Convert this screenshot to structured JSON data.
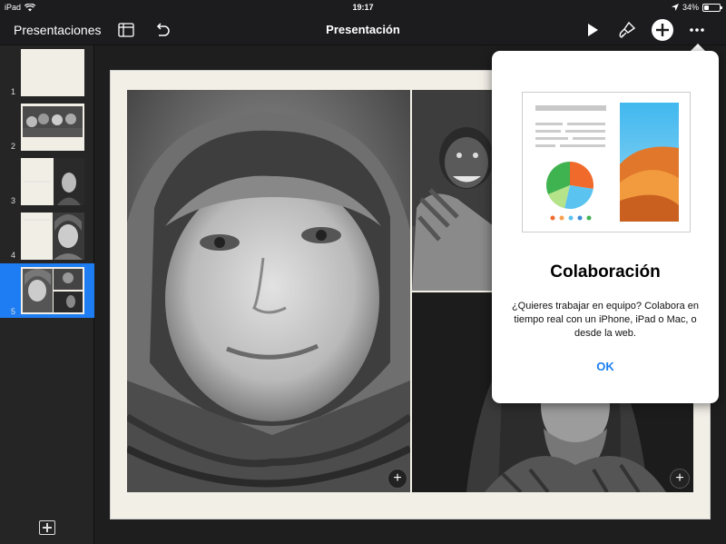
{
  "status_bar": {
    "device": "iPad",
    "time": "19:17",
    "battery": "34%",
    "battery_level": 0.34
  },
  "toolbar": {
    "back_label": "Presentaciones",
    "title": "Presentación",
    "icons": [
      "sidebar-layout-icon",
      "undo-icon",
      "play-icon",
      "paintbrush-icon",
      "add-icon",
      "more-icon"
    ]
  },
  "sidebar": {
    "slides": [
      {
        "number": "1"
      },
      {
        "number": "2"
      },
      {
        "number": "3"
      },
      {
        "number": "4"
      },
      {
        "number": "5",
        "selected": true
      }
    ]
  },
  "popover": {
    "title": "Colaboración",
    "body": "¿Quieres trabajar en equipo? Colabora en tiempo real con un iPhone, iPad o Mac, o desde la web.",
    "ok_label": "OK"
  },
  "colors": {
    "accent": "#1a7ff0",
    "selection": "#1e7df2"
  }
}
